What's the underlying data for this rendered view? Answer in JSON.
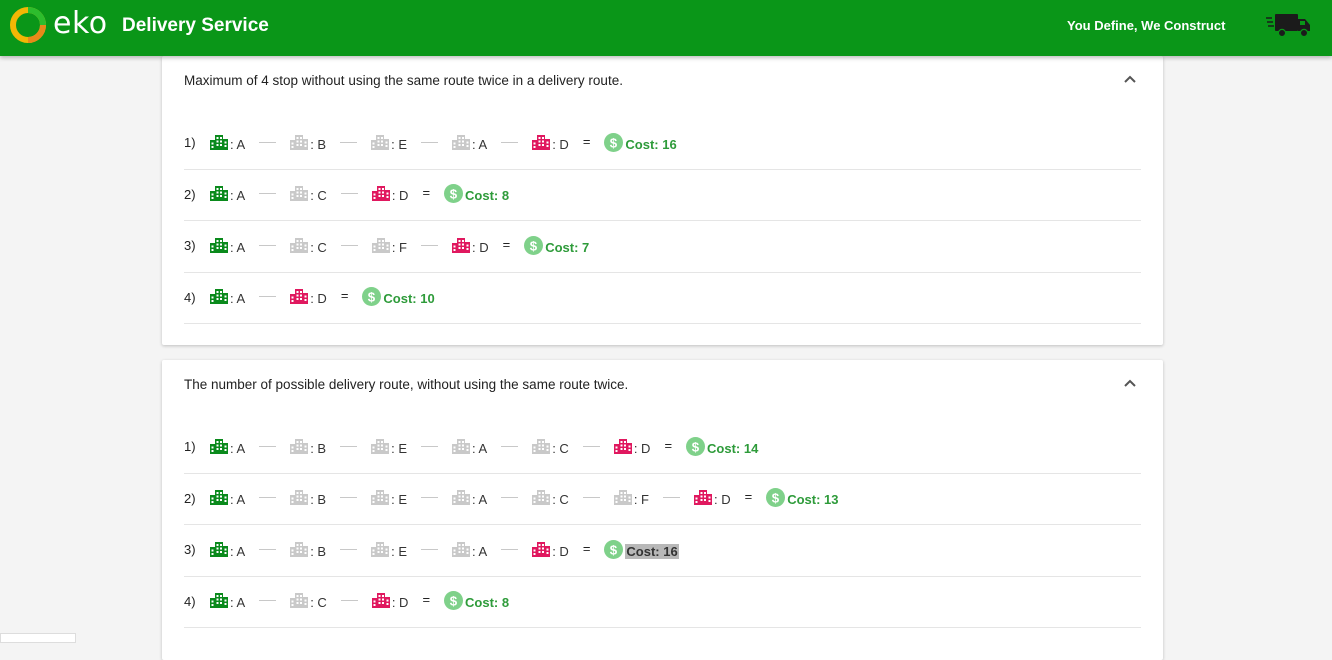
{
  "header": {
    "brand": "eko",
    "title": "Delivery Service",
    "tagline": "You Define, We Construct"
  },
  "colors": {
    "appbar": "#0a9618",
    "origin": "#0a8a1c",
    "via": "#c9c9c9",
    "destination": "#e0185f",
    "cost": "#2e9b3a",
    "cost_icon": "#7fd18a"
  },
  "icons": {
    "stop": "city-building-icon",
    "cost": "dollar-circle-icon",
    "collapse": "chevron-up-icon",
    "truck": "delivery-truck-icon"
  },
  "panels": [
    {
      "title": "Maximum of 4 stop without using the same route twice in a delivery route.",
      "routes": [
        {
          "index": "1)",
          "stops": [
            "A",
            "B",
            "E",
            "A",
            "D"
          ],
          "cost": "Cost: 16"
        },
        {
          "index": "2)",
          "stops": [
            "A",
            "C",
            "D"
          ],
          "cost": "Cost: 8"
        },
        {
          "index": "3)",
          "stops": [
            "A",
            "C",
            "F",
            "D"
          ],
          "cost": "Cost: 7"
        },
        {
          "index": "4)",
          "stops": [
            "A",
            "D"
          ],
          "cost": "Cost: 10"
        }
      ]
    },
    {
      "title": "The number of possible delivery route, without using the same route twice.",
      "routes": [
        {
          "index": "1)",
          "stops": [
            "A",
            "B",
            "E",
            "A",
            "C",
            "D"
          ],
          "cost": "Cost: 14"
        },
        {
          "index": "2)",
          "stops": [
            "A",
            "B",
            "E",
            "A",
            "C",
            "F",
            "D"
          ],
          "cost": "Cost: 13"
        },
        {
          "index": "3)",
          "stops": [
            "A",
            "B",
            "E",
            "A",
            "D"
          ],
          "cost": "Cost: 16",
          "highlighted": true
        },
        {
          "index": "4)",
          "stops": [
            "A",
            "C",
            "D"
          ],
          "cost": "Cost: 8"
        }
      ]
    }
  ]
}
